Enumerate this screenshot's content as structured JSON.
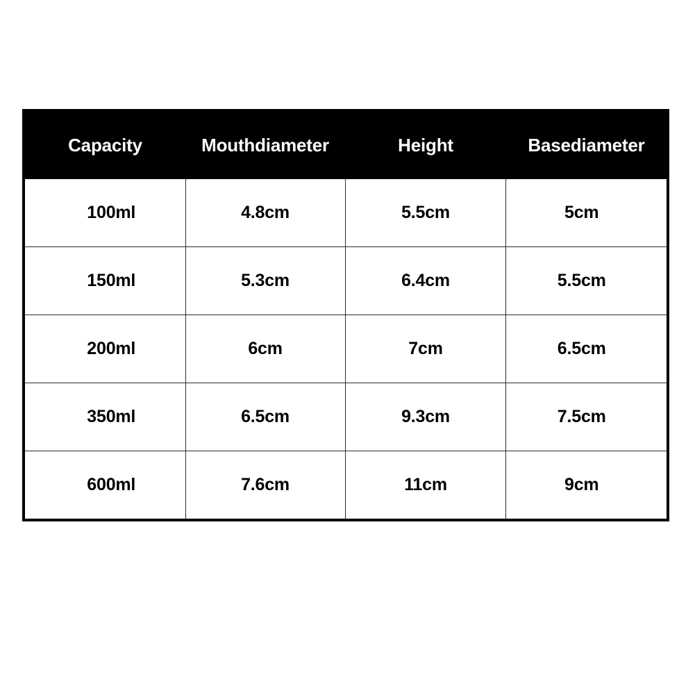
{
  "table": {
    "columns": [
      {
        "key": "capacity",
        "label": "Capacity"
      },
      {
        "key": "mouthdiameter",
        "label": "Mouthdiameter"
      },
      {
        "key": "height",
        "label": "Height"
      },
      {
        "key": "basediameter",
        "label": "Basediameter"
      }
    ],
    "header_background": "#000000",
    "header_text_color": "#ffffff",
    "body_background": "#ffffff",
    "body_text_color": "#000000",
    "border_color": "#000000",
    "rows": [
      {
        "capacity": "100ml",
        "mouthdiameter": "4.8cm",
        "height": "5.5cm",
        "basediameter": "5cm"
      },
      {
        "capacity": "150ml",
        "mouthdiameter": "5.3cm",
        "height": "6.4cm",
        "basediameter": "5.5cm"
      },
      {
        "capacity": "200ml",
        "mouthdiameter": "6cm",
        "height": "7cm",
        "basediameter": "6.5cm"
      },
      {
        "capacity": "350ml",
        "mouthdiameter": "6.5cm",
        "height": "9.3cm",
        "basediameter": "7.5cm"
      },
      {
        "capacity": "600ml",
        "mouthdiameter": "7.6cm",
        "height": "11cm",
        "basediameter": "9cm"
      }
    ]
  }
}
